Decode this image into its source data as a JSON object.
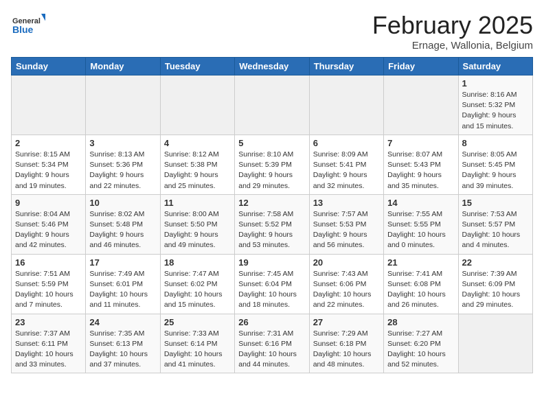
{
  "header": {
    "logo_general": "General",
    "logo_blue": "Blue",
    "month_title": "February 2025",
    "location": "Ernage, Wallonia, Belgium"
  },
  "weekdays": [
    "Sunday",
    "Monday",
    "Tuesday",
    "Wednesday",
    "Thursday",
    "Friday",
    "Saturday"
  ],
  "weeks": [
    [
      {
        "day": "",
        "info": ""
      },
      {
        "day": "",
        "info": ""
      },
      {
        "day": "",
        "info": ""
      },
      {
        "day": "",
        "info": ""
      },
      {
        "day": "",
        "info": ""
      },
      {
        "day": "",
        "info": ""
      },
      {
        "day": "1",
        "info": "Sunrise: 8:16 AM\nSunset: 5:32 PM\nDaylight: 9 hours and 15 minutes."
      }
    ],
    [
      {
        "day": "2",
        "info": "Sunrise: 8:15 AM\nSunset: 5:34 PM\nDaylight: 9 hours and 19 minutes."
      },
      {
        "day": "3",
        "info": "Sunrise: 8:13 AM\nSunset: 5:36 PM\nDaylight: 9 hours and 22 minutes."
      },
      {
        "day": "4",
        "info": "Sunrise: 8:12 AM\nSunset: 5:38 PM\nDaylight: 9 hours and 25 minutes."
      },
      {
        "day": "5",
        "info": "Sunrise: 8:10 AM\nSunset: 5:39 PM\nDaylight: 9 hours and 29 minutes."
      },
      {
        "day": "6",
        "info": "Sunrise: 8:09 AM\nSunset: 5:41 PM\nDaylight: 9 hours and 32 minutes."
      },
      {
        "day": "7",
        "info": "Sunrise: 8:07 AM\nSunset: 5:43 PM\nDaylight: 9 hours and 35 minutes."
      },
      {
        "day": "8",
        "info": "Sunrise: 8:05 AM\nSunset: 5:45 PM\nDaylight: 9 hours and 39 minutes."
      }
    ],
    [
      {
        "day": "9",
        "info": "Sunrise: 8:04 AM\nSunset: 5:46 PM\nDaylight: 9 hours and 42 minutes."
      },
      {
        "day": "10",
        "info": "Sunrise: 8:02 AM\nSunset: 5:48 PM\nDaylight: 9 hours and 46 minutes."
      },
      {
        "day": "11",
        "info": "Sunrise: 8:00 AM\nSunset: 5:50 PM\nDaylight: 9 hours and 49 minutes."
      },
      {
        "day": "12",
        "info": "Sunrise: 7:58 AM\nSunset: 5:52 PM\nDaylight: 9 hours and 53 minutes."
      },
      {
        "day": "13",
        "info": "Sunrise: 7:57 AM\nSunset: 5:53 PM\nDaylight: 9 hours and 56 minutes."
      },
      {
        "day": "14",
        "info": "Sunrise: 7:55 AM\nSunset: 5:55 PM\nDaylight: 10 hours and 0 minutes."
      },
      {
        "day": "15",
        "info": "Sunrise: 7:53 AM\nSunset: 5:57 PM\nDaylight: 10 hours and 4 minutes."
      }
    ],
    [
      {
        "day": "16",
        "info": "Sunrise: 7:51 AM\nSunset: 5:59 PM\nDaylight: 10 hours and 7 minutes."
      },
      {
        "day": "17",
        "info": "Sunrise: 7:49 AM\nSunset: 6:01 PM\nDaylight: 10 hours and 11 minutes."
      },
      {
        "day": "18",
        "info": "Sunrise: 7:47 AM\nSunset: 6:02 PM\nDaylight: 10 hours and 15 minutes."
      },
      {
        "day": "19",
        "info": "Sunrise: 7:45 AM\nSunset: 6:04 PM\nDaylight: 10 hours and 18 minutes."
      },
      {
        "day": "20",
        "info": "Sunrise: 7:43 AM\nSunset: 6:06 PM\nDaylight: 10 hours and 22 minutes."
      },
      {
        "day": "21",
        "info": "Sunrise: 7:41 AM\nSunset: 6:08 PM\nDaylight: 10 hours and 26 minutes."
      },
      {
        "day": "22",
        "info": "Sunrise: 7:39 AM\nSunset: 6:09 PM\nDaylight: 10 hours and 29 minutes."
      }
    ],
    [
      {
        "day": "23",
        "info": "Sunrise: 7:37 AM\nSunset: 6:11 PM\nDaylight: 10 hours and 33 minutes."
      },
      {
        "day": "24",
        "info": "Sunrise: 7:35 AM\nSunset: 6:13 PM\nDaylight: 10 hours and 37 minutes."
      },
      {
        "day": "25",
        "info": "Sunrise: 7:33 AM\nSunset: 6:14 PM\nDaylight: 10 hours and 41 minutes."
      },
      {
        "day": "26",
        "info": "Sunrise: 7:31 AM\nSunset: 6:16 PM\nDaylight: 10 hours and 44 minutes."
      },
      {
        "day": "27",
        "info": "Sunrise: 7:29 AM\nSunset: 6:18 PM\nDaylight: 10 hours and 48 minutes."
      },
      {
        "day": "28",
        "info": "Sunrise: 7:27 AM\nSunset: 6:20 PM\nDaylight: 10 hours and 52 minutes."
      },
      {
        "day": "",
        "info": ""
      }
    ]
  ]
}
